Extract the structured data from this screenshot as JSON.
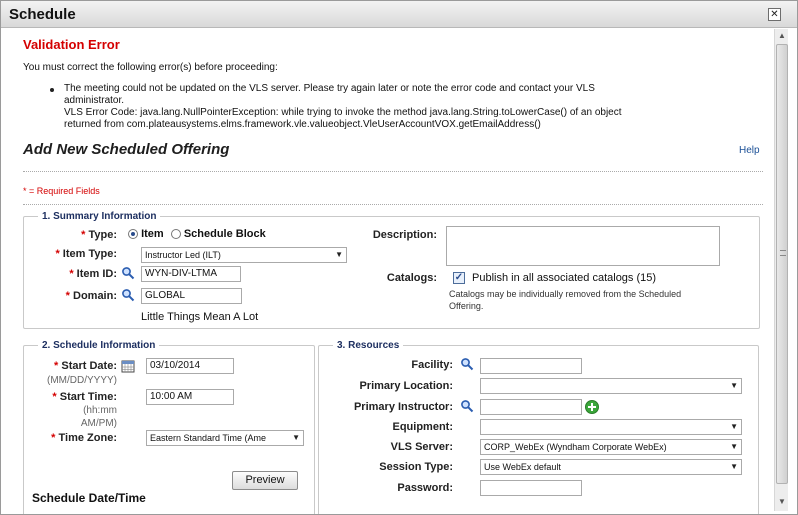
{
  "dialog": {
    "title": "Schedule",
    "close": "✕"
  },
  "validation": {
    "title": "Validation Error",
    "intro": "You must correct the following error(s) before proceeding:",
    "lines": [
      "The meeting could not be updated on the VLS server. Please try again later or note the error code and contact your VLS",
      "administrator.",
      "VLS Error Code: java.lang.NullPointerException: while trying to invoke the method java.lang.String.toLowerCase() of an object",
      "returned from com.plateausystems.elms.framework.vle.valueobject.VleUserAccountVOX.getEmailAddress()"
    ]
  },
  "page": {
    "heading": "Add New Scheduled Offering",
    "help": "Help",
    "required_note": "* = Required Fields"
  },
  "summary": {
    "legend": "1. Summary Information",
    "type_label": "Type:",
    "type_options": [
      {
        "label": "Item",
        "selected": true
      },
      {
        "label": "Schedule Block",
        "selected": false
      }
    ],
    "item_type_label": "Item Type:",
    "item_type_value": "Instructor Led (ILT)",
    "item_id_label": "Item ID:",
    "item_id_value": "WYN-DIV-LTMA",
    "domain_label": "Domain:",
    "domain_value": "GLOBAL",
    "item_title": "Little Things Mean A Lot",
    "description_label": "Description:",
    "description_value": "",
    "catalogs_label": "Catalogs:",
    "catalogs_checked": true,
    "catalogs_text": "Publish in all associated catalogs (15)",
    "catalogs_note_1": "Catalogs may be individually removed from the Scheduled",
    "catalogs_note_2": "Offering."
  },
  "schedule": {
    "legend": "2. Schedule Information",
    "start_date_label": "Start Date:",
    "start_date_value": "03/10/2014",
    "start_date_hint": "(MM/DD/YYYY)",
    "start_time_label": "Start Time:",
    "start_time_value": "10:00 AM",
    "start_time_hint_1": "(hh:mm",
    "start_time_hint_2": "AM/PM)",
    "time_zone_label": "Time Zone:",
    "time_zone_value": "Eastern Standard Time (Ame",
    "preview_button": "Preview",
    "date_time_heading": "Schedule Date/Time"
  },
  "resources": {
    "legend": "3. Resources",
    "facility_label": "Facility:",
    "facility_value": "",
    "primary_location_label": "Primary Location:",
    "primary_location_value": "",
    "primary_instructor_label": "Primary Instructor:",
    "primary_instructor_value": "",
    "equipment_label": "Equipment:",
    "equipment_value": "",
    "vls_server_label": "VLS Server:",
    "vls_server_value": "CORP_WebEx (Wyndham Corporate WebEx)",
    "session_type_label": "Session Type:",
    "session_type_value": "Use WebEx default",
    "password_label": "Password:",
    "password_value": ""
  },
  "colors": {
    "error": "#d40000",
    "legend": "#1d2f60",
    "link": "#1a4f96",
    "add_button": "#3aa63a"
  },
  "icons": [
    "close-icon",
    "search-icon",
    "calendar-icon",
    "add-icon",
    "caret-down-icon",
    "scroll-up-icon",
    "scroll-down-icon"
  ]
}
